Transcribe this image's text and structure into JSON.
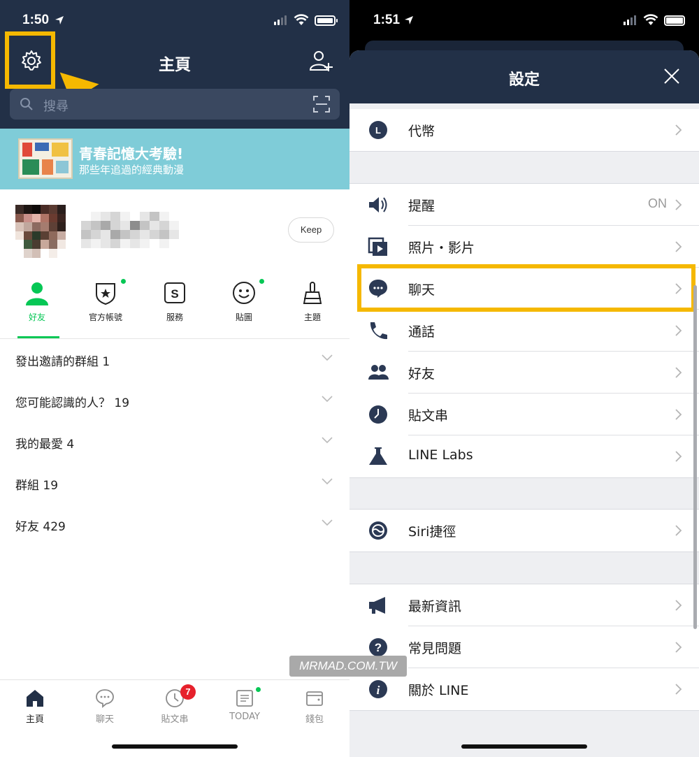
{
  "left": {
    "status": {
      "time": "1:50"
    },
    "header": {
      "title": "主頁"
    },
    "search": {
      "placeholder": "搜尋"
    },
    "banner": {
      "title": "青春記憶大考驗!",
      "subtitle": "那些年追過的經典動漫"
    },
    "profile": {
      "keep_label": "Keep"
    },
    "categories": [
      {
        "label": "好友",
        "icon": "friends-icon",
        "active": true
      },
      {
        "label": "官方帳號",
        "icon": "official-account-icon"
      },
      {
        "label": "服務",
        "icon": "services-icon"
      },
      {
        "label": "貼圖",
        "icon": "sticker-icon"
      },
      {
        "label": "主題",
        "icon": "theme-icon"
      }
    ],
    "friend_sections": [
      {
        "label": "發出邀請的群組 1"
      },
      {
        "label": "您可能認識的人？ 19"
      },
      {
        "label": "我的最愛 4"
      },
      {
        "label": "群組 19"
      },
      {
        "label": "好友 429"
      }
    ],
    "tabbar": [
      {
        "label": "主頁",
        "icon": "home-icon",
        "active": true
      },
      {
        "label": "聊天",
        "icon": "chat-icon"
      },
      {
        "label": "貼文串",
        "icon": "timeline-icon",
        "badge": "7"
      },
      {
        "label": "TODAY",
        "icon": "today-icon"
      },
      {
        "label": "錢包",
        "icon": "wallet-icon"
      }
    ],
    "colors": {
      "header": "#223047",
      "accent": "#06c755",
      "highlight": "#f5b800",
      "banner": "#7fccd8"
    }
  },
  "right": {
    "status": {
      "time": "1:51"
    },
    "header": {
      "title": "設定"
    },
    "groups": [
      [
        {
          "label": "代幣",
          "icon": "coin-icon"
        }
      ],
      [
        {
          "label": "提醒",
          "icon": "speaker-icon",
          "value": "ON"
        },
        {
          "label": "照片・影片",
          "icon": "photo-video-icon"
        },
        {
          "label": "聊天",
          "icon": "chat-bubble-icon",
          "highlighted": true
        },
        {
          "label": "通話",
          "icon": "phone-icon"
        },
        {
          "label": "好友",
          "icon": "friends-icon"
        },
        {
          "label": "貼文串",
          "icon": "clock-icon"
        },
        {
          "label": "LINE Labs",
          "icon": "flask-icon"
        }
      ],
      [
        {
          "label": "Siri捷徑",
          "icon": "siri-icon"
        }
      ],
      [
        {
          "label": "最新資訊",
          "icon": "megaphone-icon"
        },
        {
          "label": "常見問題",
          "icon": "question-icon"
        },
        {
          "label": "關於 LINE",
          "icon": "info-icon"
        }
      ]
    ],
    "watermark": "MRMAD.COM.TW"
  }
}
